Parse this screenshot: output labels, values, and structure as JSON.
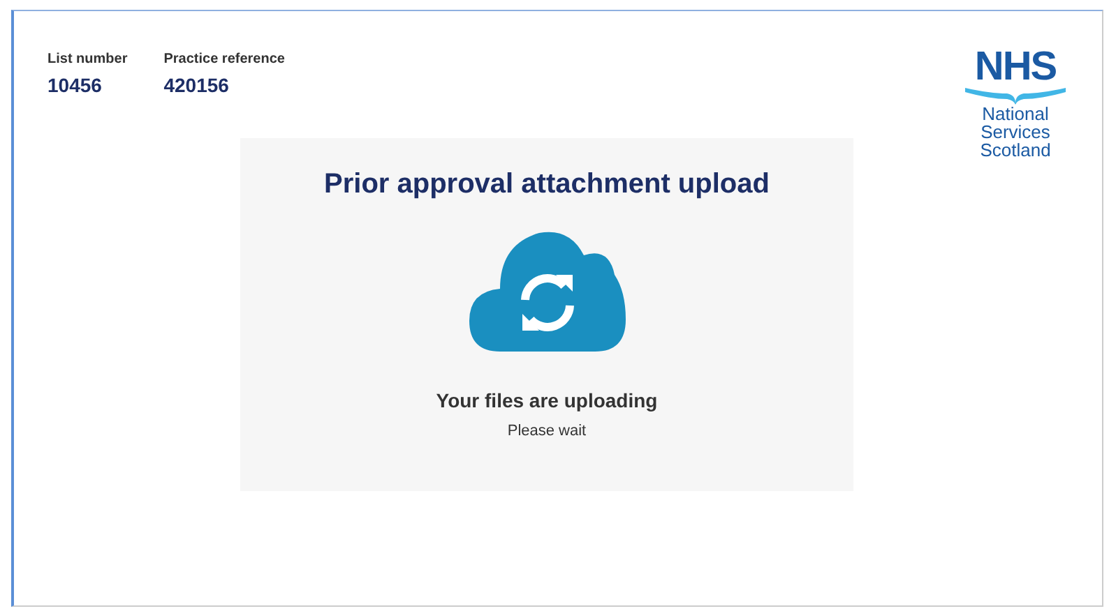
{
  "header": {
    "fields": [
      {
        "label": "List number",
        "value": "10456"
      },
      {
        "label": "Practice reference",
        "value": "420156"
      }
    ]
  },
  "logo": {
    "mark": "NHS",
    "lines": [
      "National",
      "Services",
      "Scotland"
    ]
  },
  "card": {
    "title": "Prior approval attachment upload",
    "status": "Your files are uploading",
    "hint": "Please wait"
  }
}
